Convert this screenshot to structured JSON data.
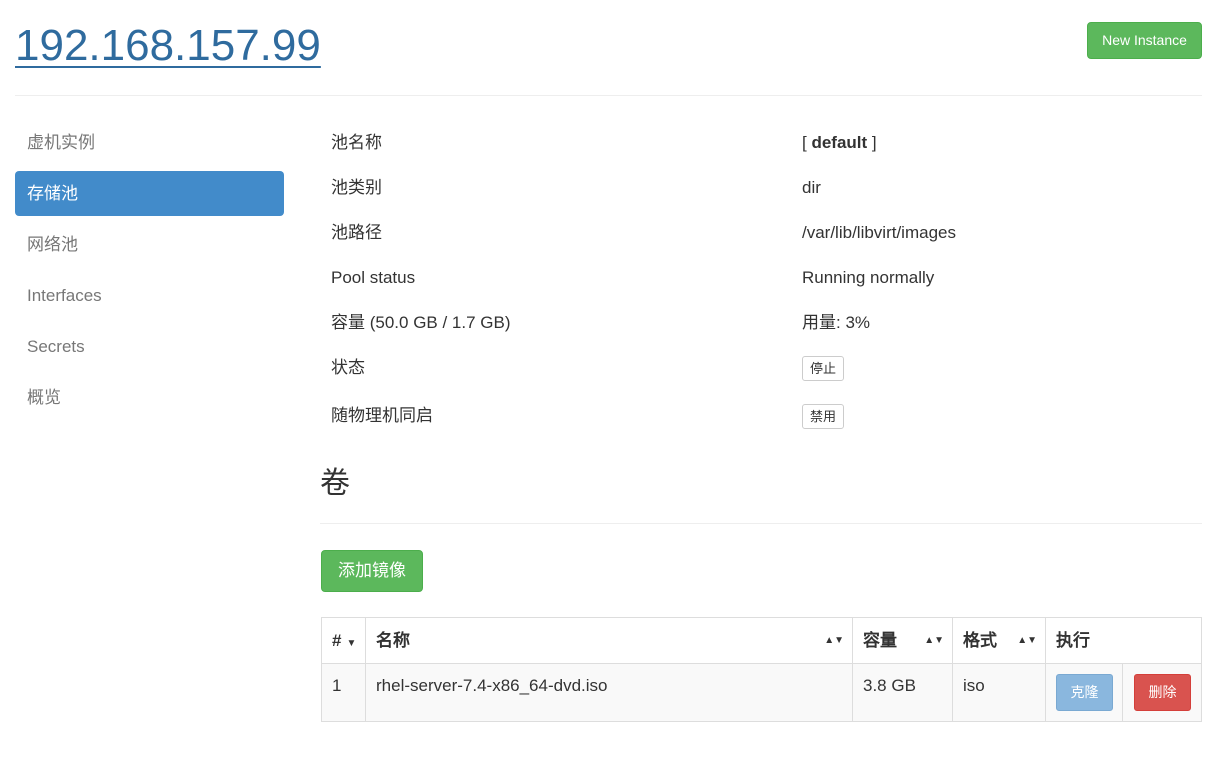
{
  "header": {
    "host": "192.168.157.99",
    "new_instance": "New Instance"
  },
  "nav": {
    "items": [
      {
        "label": "虚机实例",
        "active": false
      },
      {
        "label": "存储池",
        "active": true
      },
      {
        "label": "网络池",
        "active": false
      },
      {
        "label": "Interfaces",
        "active": false
      },
      {
        "label": "Secrets",
        "active": false
      },
      {
        "label": "概览",
        "active": false
      }
    ]
  },
  "pool": {
    "name_label": "池名称",
    "name_prefix": "[ ",
    "name_value": "default",
    "name_suffix": " ]",
    "type_label": "池类别",
    "type_value": "dir",
    "path_label": "池路径",
    "path_value": "/var/lib/libvirt/images",
    "status_label": "Pool status",
    "status_value": "Running normally",
    "capacity_label": "容量 (50.0 GB / 1.7 GB)",
    "usage_value": "用量: 3%",
    "state_label": "状态",
    "state_button": "停止",
    "autostart_label": "随物理机同启",
    "autostart_button": "禁用"
  },
  "volumes": {
    "title": "卷",
    "add_button": "添加镜像",
    "columns": {
      "index": "#",
      "name": "名称",
      "size": "容量",
      "format": "格式",
      "action": "执行"
    },
    "rows": [
      {
        "index": "1",
        "name": "rhel-server-7.4-x86_64-dvd.iso",
        "size": "3.8 GB",
        "format": "iso",
        "clone": "克隆",
        "delete": "删除"
      }
    ]
  }
}
